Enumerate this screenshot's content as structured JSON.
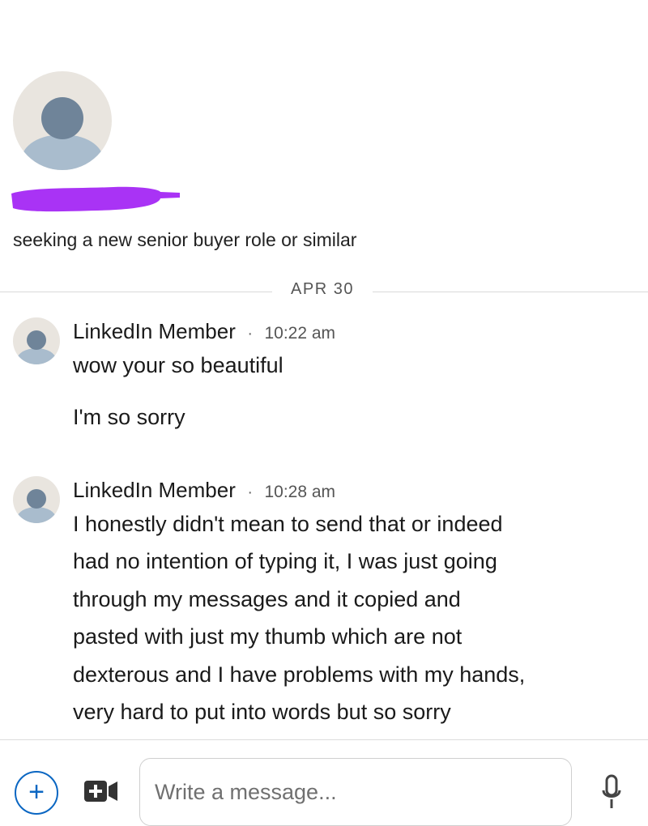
{
  "profile": {
    "headline": "seeking a new senior buyer role or similar",
    "name_redaction_color": "#a933f5"
  },
  "date_divider": "APR 30",
  "messages": [
    {
      "sender": "LinkedIn Member",
      "separator": "·",
      "time": "10:22 am",
      "lines": [
        "wow your so beautiful",
        "I'm so sorry"
      ]
    },
    {
      "sender": "LinkedIn Member",
      "separator": "·",
      "time": "10:28 am",
      "lines": [
        "I honestly didn't mean to send that or indeed",
        "had no intention of typing it, I was just going",
        "through my messages and it copied and",
        "pasted with just my thumb which are not",
        "dexterous and I have problems with my hands,",
        "very hard to put into words but so sorry"
      ]
    }
  ],
  "composer": {
    "plus_label": "+",
    "placeholder": "Write a message...",
    "icons": [
      "plus-icon",
      "video-icon",
      "microphone-icon"
    ]
  },
  "colors": {
    "accent": "#0a66c2",
    "avatar_bg": "#e9e5df",
    "avatar_body": "#a9bccd",
    "avatar_head": "#6f8499"
  }
}
